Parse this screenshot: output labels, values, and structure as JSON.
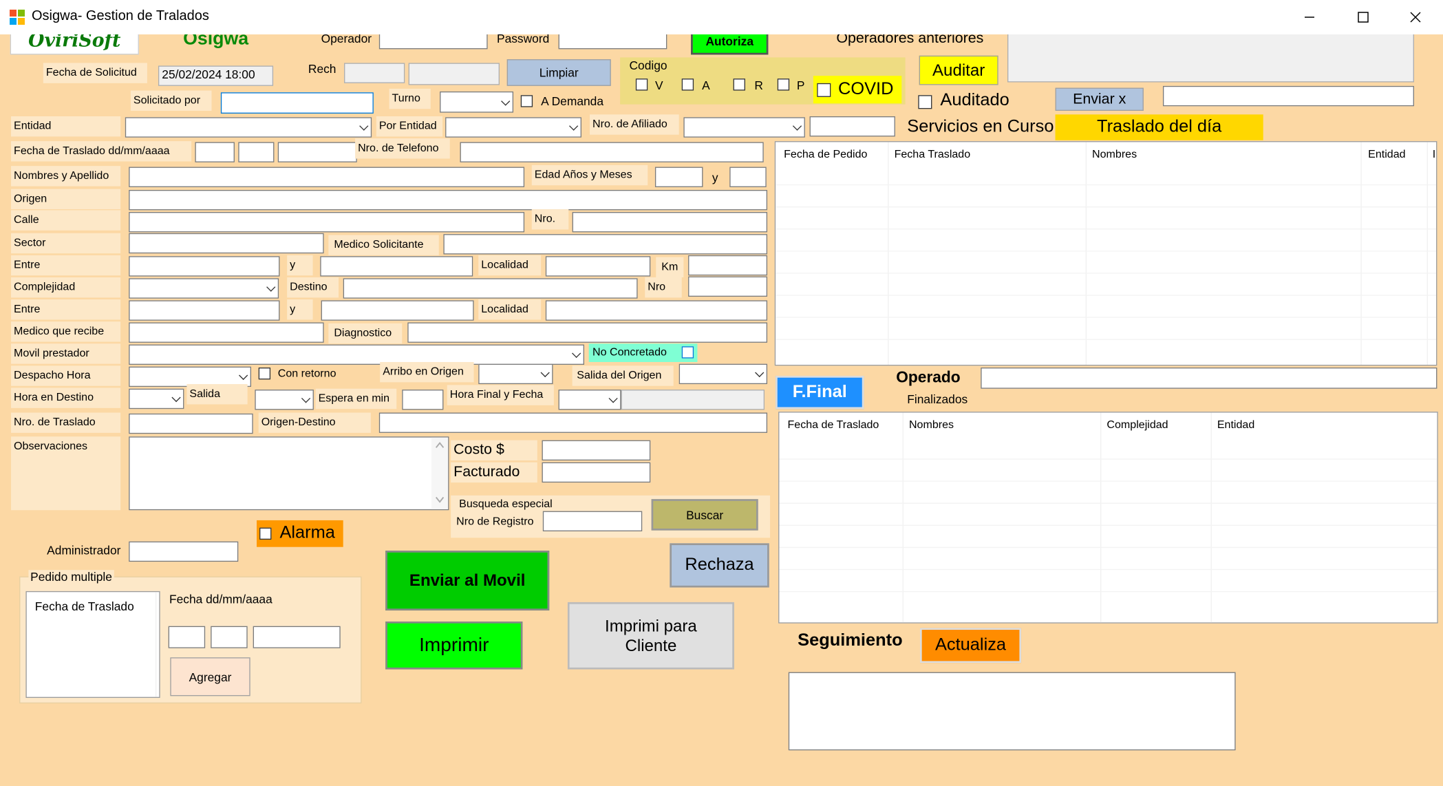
{
  "window": {
    "title": "Osigwa- Gestion de Tralados",
    "icon": "app-windows-icon",
    "controls": [
      "minimize-icon",
      "maximize-icon",
      "close-icon"
    ]
  },
  "branding": {
    "logo_text": "OviriSoft",
    "app_name": "Osigwa"
  },
  "login": {
    "operador_label": "Operador",
    "operador_value": "",
    "password_label": "Password",
    "password_value": "",
    "autoriza_button": "Autoriza",
    "operadores_anteriores_label": "Operadores anteriores"
  },
  "header": {
    "rech_label": "Rech",
    "limpiar_button": "Limpiar",
    "fecha_solicitud_label": "Fecha de Solicitud",
    "fecha_solicitud_value": "25/02/2024 18:00",
    "solicitado_por_label": "Solicitado por",
    "turno_label": "Turno",
    "a_demanda_label": "A Demanda",
    "codigo_label": "Codigo",
    "codigo_options": [
      "V",
      "A",
      "R",
      "P"
    ],
    "covid_label": "COVID",
    "auditar_button": "Auditar",
    "auditado_label": "Auditado",
    "enviar_x_button": "Enviar  x"
  },
  "form": {
    "entidad": "Entidad",
    "por_entidad": "Por Entidad",
    "nro_afiliado": "Nro. de Afiliado",
    "fecha_traslado": "Fecha de Traslado dd/mm/aaaa",
    "nro_telefono": "Nro. de Telefono",
    "nombres_apellido": "Nombres y Apellido",
    "edad": "Edad Años y Meses",
    "y": "y",
    "origen": "Origen",
    "calle": "Calle",
    "nro": "Nro.",
    "sector": "Sector",
    "medico_solicitante": "Medico Solicitante",
    "entre": "Entre",
    "localidad": "Localidad",
    "km": "Km",
    "complejidad": "Complejidad",
    "destino": "Destino",
    "nro2": "Nro",
    "medico_recibe": "Medico que recibe",
    "diagnostico": "Diagnostico",
    "movil_prestador": "Movil  prestador",
    "no_concretado": "No Concretado",
    "despacho_hora": "Despacho Hora",
    "con_retorno": "Con retorno",
    "arribo_origen": "Arribo en Origen",
    "salida_origen": "Salida del Origen",
    "hora_destino": "Hora en Destino",
    "salida": "Salida",
    "espera_min": "Espera en min",
    "hora_final_fecha": "Hora Final y Fecha",
    "nro_traslado": "Nro. de Traslado",
    "origen_destino": "Origen-Destino",
    "observaciones": "Observaciones",
    "costo": "Costo $",
    "facturado": "Facturado",
    "busqueda_especial": "Busqueda especial",
    "nro_registro": "Nro de Registro",
    "buscar_button": "Buscar"
  },
  "bottom_left": {
    "alarma_label": "Alarma",
    "administrador_label": "Administrador",
    "pedido_multiple_label": "Pedido multiple",
    "fecha_traslado_header": "Fecha de Traslado",
    "fecha_format_label": "Fecha dd/mm/aaaa",
    "agregar_button": "Agregar"
  },
  "actions": {
    "enviar_movil_button": "Enviar al Movil",
    "imprimir_button": "Imprimir",
    "imprimi_cliente_button": "Imprimi para Cliente",
    "rechaza_button": "Rechaza"
  },
  "right_panel": {
    "servicios_label": "Servicios en Curso",
    "traslado_dia_label": "Traslado del día",
    "servicios_columns": [
      "Fecha de Pedido",
      "Fecha Traslado",
      "Nombres",
      "Entidad",
      "I"
    ],
    "ffinal_button": "F.Final",
    "operado_label": "Operado",
    "finalizados_label": "Finalizados",
    "finalizados_columns": [
      "Fecha de Traslado",
      "Nombres",
      "Complejidad",
      "Entidad"
    ],
    "seguimiento_label": "Seguimiento",
    "actualiza_button": "Actualiza"
  },
  "colors": {
    "background": "#fcd8a4",
    "label_bg": "#fde8c8",
    "autoriza_green": "#00ff00",
    "enviar_movil_green": "#00cc00",
    "imprimir_green": "#00ff00",
    "auditar_yellow": "#ffff00",
    "traslado_dia_gold": "#ffd700",
    "ffinal_blue": "#1e90ff",
    "actualiza_orange": "#ff8c00",
    "alarma_orange": "#ff9900",
    "no_concretado_aqua": "#7fffd4",
    "limpiar_blue": "#b0c4de",
    "buscar_olive": "#bdb76b"
  }
}
